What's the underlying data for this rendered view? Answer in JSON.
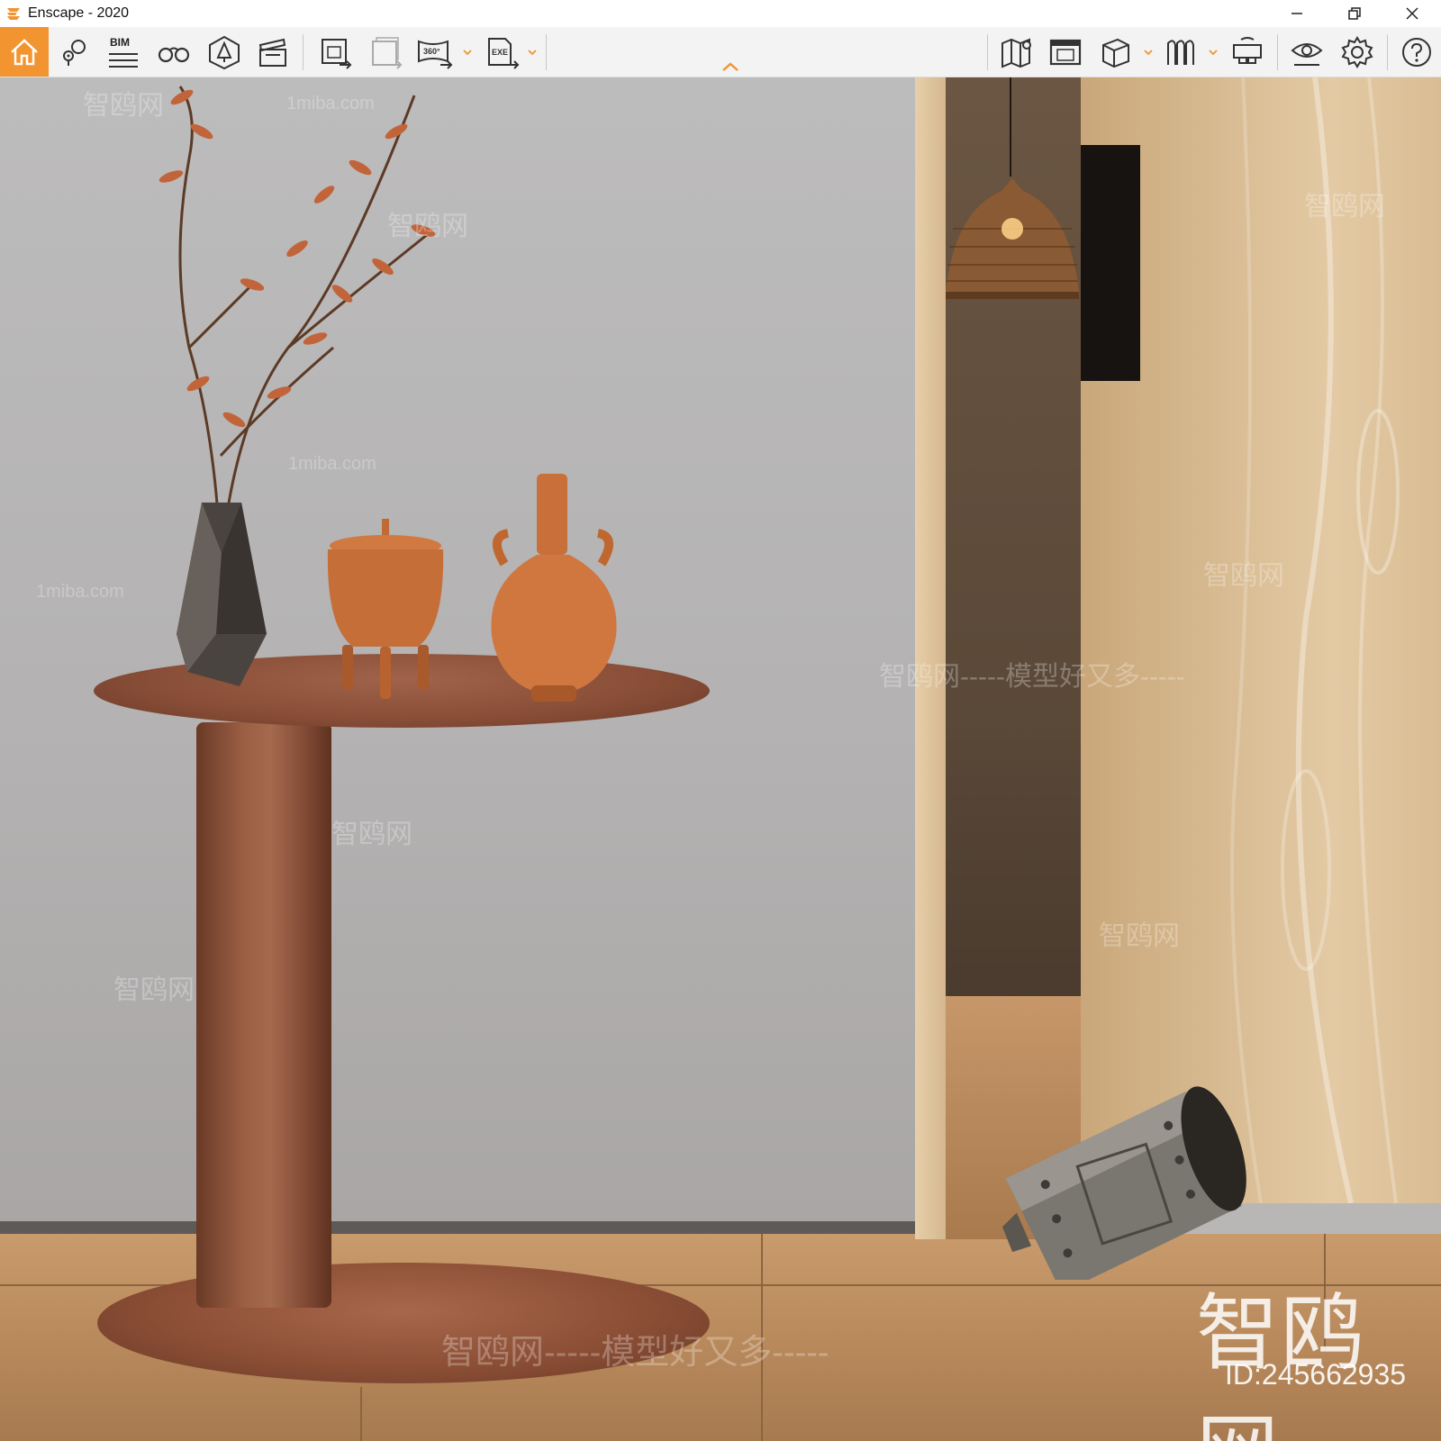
{
  "window": {
    "title": "Enscape - 2020",
    "controls": {
      "minimize": "minimize-icon",
      "restore": "restore-icon",
      "close": "close-icon"
    }
  },
  "toolbar": {
    "accent_color": "#f29430",
    "left_tools": [
      {
        "name": "home",
        "icon": "home-icon"
      },
      {
        "name": "views",
        "icon": "views-pin-icon"
      },
      {
        "name": "bim",
        "icon": "bim-icon",
        "label": "BIM"
      },
      {
        "name": "binoculars",
        "icon": "binoculars-icon"
      },
      {
        "name": "asset-library",
        "icon": "asset-library-icon"
      },
      {
        "name": "video-editor",
        "icon": "clapperboard-icon"
      },
      {
        "name": "screenshot",
        "icon": "screenshot-export-icon"
      },
      {
        "name": "batch-render",
        "icon": "batch-render-icon"
      },
      {
        "name": "panorama",
        "icon": "panorama-360-icon",
        "label": "360°"
      },
      {
        "name": "exe-export",
        "icon": "exe-export-icon",
        "label": "EXE"
      }
    ],
    "right_tools": [
      {
        "name": "map",
        "icon": "map-icon"
      },
      {
        "name": "web-standalone",
        "icon": "web-standalone-icon"
      },
      {
        "name": "cube-view",
        "icon": "cube-icon"
      },
      {
        "name": "vr-headset-list",
        "icon": "vr-mode-icon"
      },
      {
        "name": "vr-headset",
        "icon": "headset-icon"
      },
      {
        "name": "visual-settings",
        "icon": "eye-settings-icon"
      },
      {
        "name": "general-settings",
        "icon": "gear-icon"
      },
      {
        "name": "help",
        "icon": "help-icon",
        "label": "?"
      }
    ]
  },
  "viewport": {
    "watermarks": [
      {
        "text": "1miba.com"
      },
      {
        "text": "智鸥网"
      },
      {
        "text": "智鸥网-----模型好又多-----"
      }
    ],
    "brand_watermark": "智鸥网",
    "id_watermark": "ID:245662935"
  }
}
